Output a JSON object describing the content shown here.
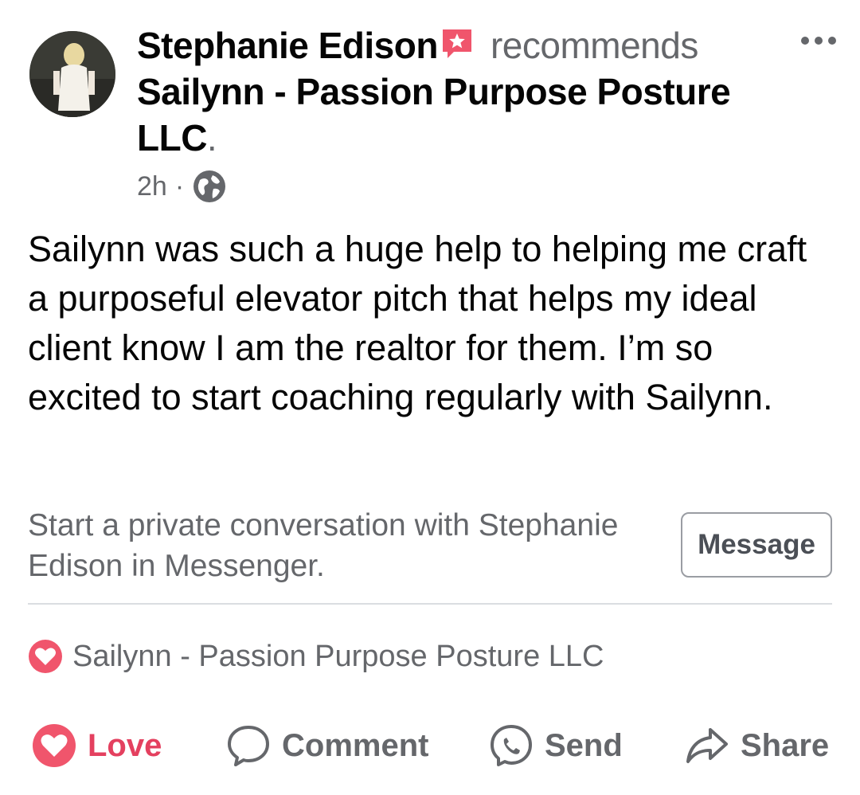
{
  "post": {
    "author": "Stephanie Edison",
    "verb": "recommends",
    "page_name": "Sailynn - Passion Purpose Posture",
    "page_name_cont": "LLC",
    "time": "2h",
    "privacy_icon": "globe-icon",
    "recommend_icon": "recommendation-badge-icon",
    "body": "Sailynn was such a huge help to helping me craft a purposeful elevator pitch that helps my ideal client know I am the realtor for them. I’m so excited to start coaching regularly with Sailynn."
  },
  "messenger_cta": {
    "text": "Start a private conversation with Stephanie Edison in Messenger.",
    "button_label": "Message"
  },
  "reactions": {
    "icon": "heart-reaction-icon",
    "text": "Sailynn - Passion Purpose Posture LLC"
  },
  "actions": [
    {
      "label": "Love",
      "icon": "heart-icon"
    },
    {
      "label": "Comment",
      "icon": "comment-icon"
    },
    {
      "label": "Send",
      "icon": "messenger-icon"
    },
    {
      "label": "Share",
      "icon": "share-icon"
    }
  ],
  "colors": {
    "love": "#e4405f",
    "secondary_text": "#65676b",
    "recommend_badge": "#f0556c"
  }
}
